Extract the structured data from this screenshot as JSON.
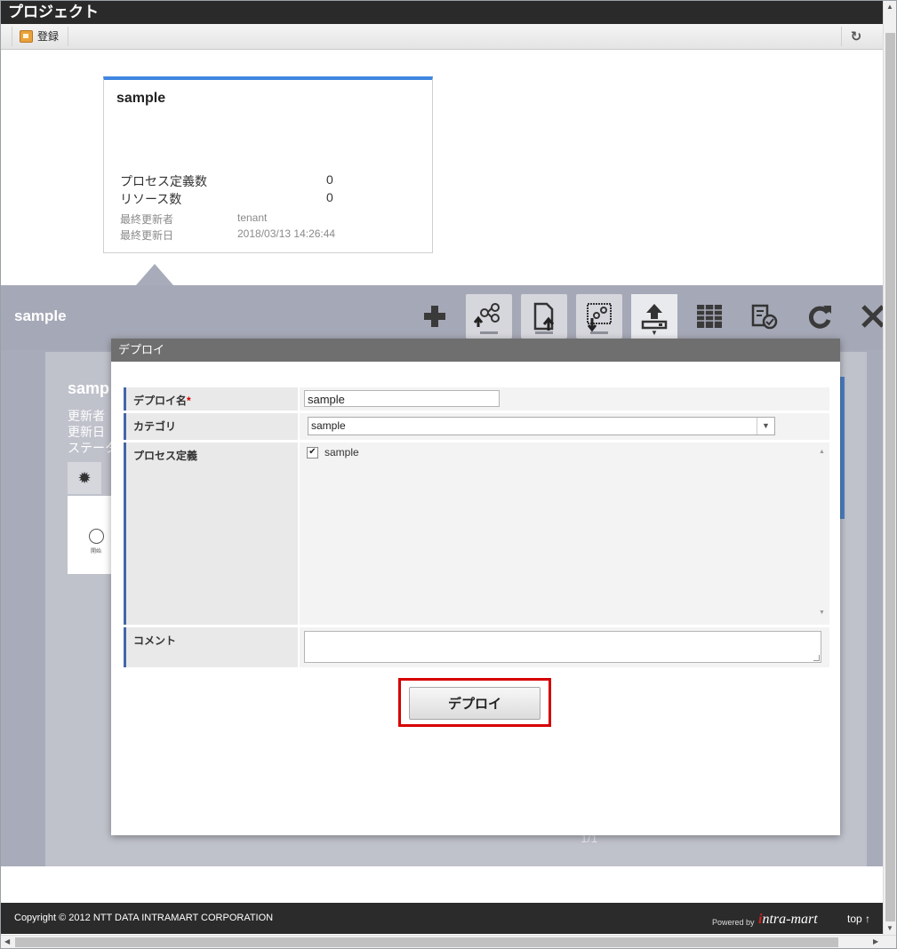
{
  "header": {
    "title": "プロジェクト",
    "register_label": "登録"
  },
  "card": {
    "name": "sample",
    "process_def_count_label": "プロセス定義数",
    "process_def_count": "0",
    "resource_count_label": "リソース数",
    "resource_count": "0",
    "last_updater_label": "最終更新者",
    "last_updater": "tenant",
    "last_updated_label": "最終更新日",
    "last_updated": "2018/03/13 14:26:44"
  },
  "panel": {
    "title": "sample",
    "bg_title": "samp",
    "bg_updater": "更新者",
    "bg_updated": "更新日",
    "bg_status": "ステータ",
    "bg_node_label": "開始",
    "pager": "1/1"
  },
  "dialog": {
    "title": "デプロイ",
    "deploy_name_label": "デプロイ名",
    "required_mark": "*",
    "deploy_name_value": "sample",
    "category_label": "カテゴリ",
    "category_value": "sample",
    "process_def_label": "プロセス定義",
    "process_def_item": "sample",
    "comment_label": "コメント",
    "comment_value": "",
    "deploy_button": "デプロイ"
  },
  "footer": {
    "copyright": "Copyright © 2012 NTT DATA INTRAMART CORPORATION",
    "powered_by": "Powered by",
    "logo_i": "i",
    "logo_rest": "ntra-mart",
    "top_link": "top ↑"
  },
  "icons": {
    "register": "register-icon",
    "refresh": "refresh-icon",
    "add": "plus-icon",
    "flow": "flow-icon",
    "file_upload": "file-upload-icon",
    "diagram_download": "diagram-download-icon",
    "deploy": "deploy-icon",
    "table": "table-icon",
    "review": "review-icon",
    "close": "close-icon"
  },
  "colors": {
    "accent": "#3f86e0",
    "highlight": "#d60000",
    "panel": "#a8abb9",
    "label_bar": "#4466a8"
  }
}
